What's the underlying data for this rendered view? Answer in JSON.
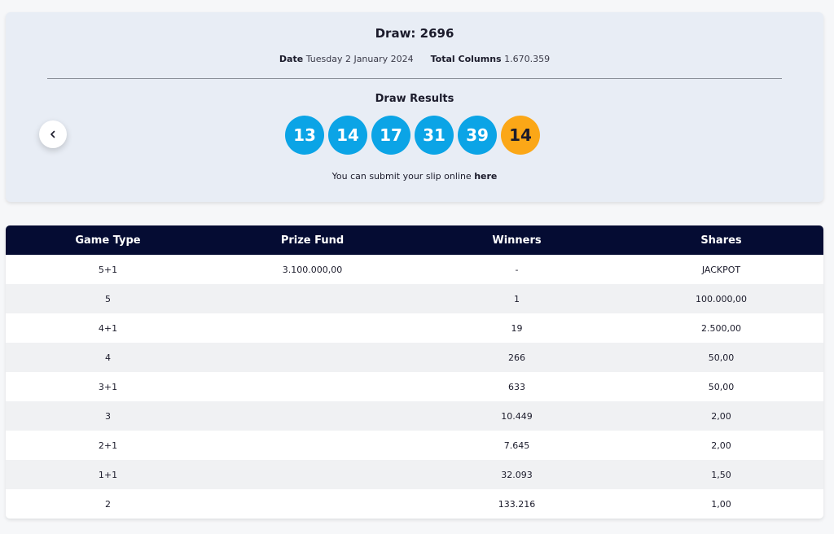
{
  "draw": {
    "title": "Draw: 2696",
    "date_label": "Date",
    "date_value": "Tuesday 2 January 2024",
    "columns_label": "Total Columns",
    "columns_value": "1.670.359",
    "results_title": "Draw Results",
    "balls": [
      "13",
      "14",
      "17",
      "31",
      "39"
    ],
    "bonus_ball": "14",
    "submit_text": "You can submit your slip online ",
    "submit_link": "here",
    "prev_icon": "chevron-left-icon"
  },
  "colors": {
    "ball": "#0ba4e6",
    "bonus_ball": "#fba717",
    "table_header": "#050c33",
    "card_bg": "#e8edf5"
  },
  "table": {
    "headers": [
      "Game Type",
      "Prize Fund",
      "Winners",
      "Shares"
    ],
    "rows": [
      [
        "5+1",
        "3.100.000,00",
        "-",
        "JACKPOT"
      ],
      [
        "5",
        "",
        "1",
        "100.000,00"
      ],
      [
        "4+1",
        "",
        "19",
        "2.500,00"
      ],
      [
        "4",
        "",
        "266",
        "50,00"
      ],
      [
        "3+1",
        "",
        "633",
        "50,00"
      ],
      [
        "3",
        "",
        "10.449",
        "2,00"
      ],
      [
        "2+1",
        "",
        "7.645",
        "2,00"
      ],
      [
        "1+1",
        "",
        "32.093",
        "1,50"
      ],
      [
        "2",
        "",
        "133.216",
        "1,00"
      ]
    ]
  }
}
